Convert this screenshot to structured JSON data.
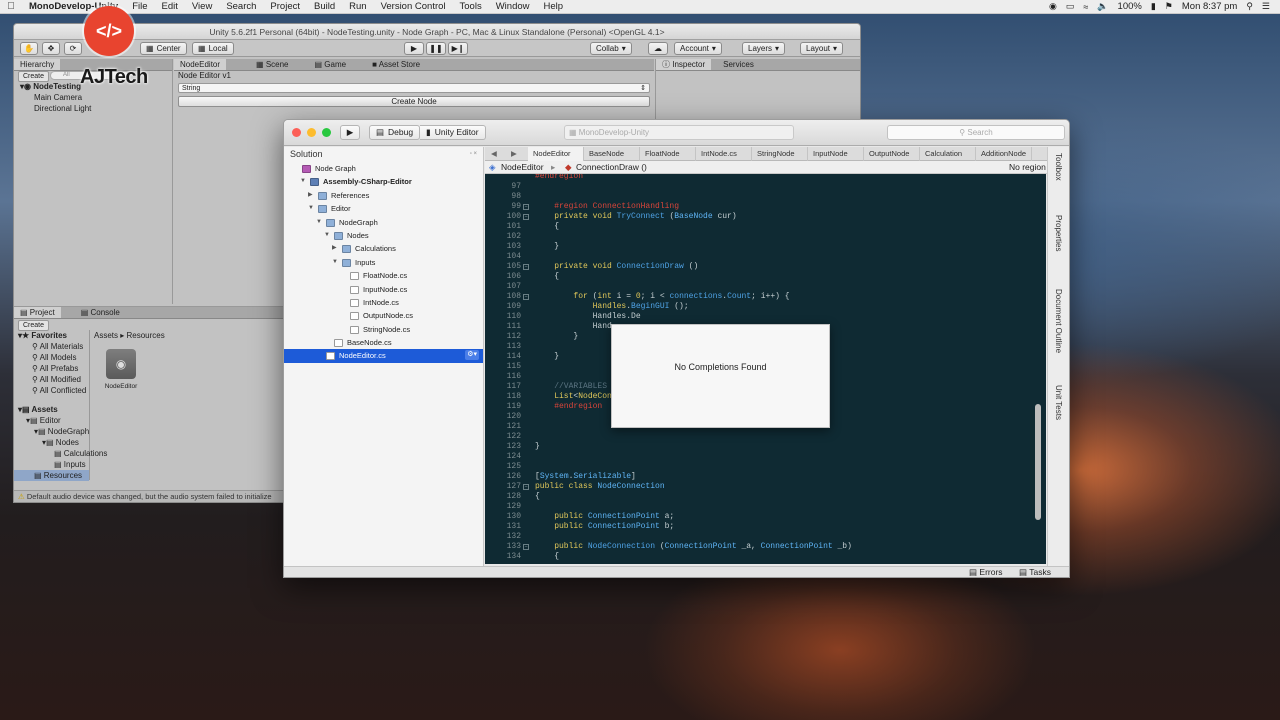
{
  "menubar": {
    "app": "MonoDevelop-Unity",
    "items": [
      "File",
      "Edit",
      "View",
      "Search",
      "Project",
      "Build",
      "Run",
      "Version Control",
      "Tools",
      "Window",
      "Help"
    ],
    "battery": "100%",
    "clock": "Mon 8:37 pm"
  },
  "watermark": {
    "text": "AJTech"
  },
  "unity": {
    "title": "Unity 5.6.2f1 Personal (64bit) - NodeTesting.unity - Node Graph - PC, Mac & Linux Standalone (Personal) <OpenGL 4.1>",
    "toolbar": {
      "center": "Center",
      "local": "Local",
      "collab": "Collab",
      "account": "Account",
      "layers": "Layers",
      "layout": "Layout"
    },
    "hierarchy": {
      "tab": "Hierarchy",
      "create": "Create",
      "search": "All",
      "scene": "NodeTesting",
      "items": [
        "Main Camera",
        "Directional Light"
      ]
    },
    "tabs": [
      "NodeEditor",
      "Scene",
      "Game",
      "Asset Store"
    ],
    "node_editor": {
      "title": "Node Editor v1",
      "field": "String",
      "button": "Create Node"
    },
    "inspector_tabs": [
      "Inspector",
      "Services"
    ],
    "project": {
      "tabs": [
        "Project",
        "Console"
      ],
      "create": "Create",
      "favorites": "Favorites",
      "fav_items": [
        "All Materials",
        "All Models",
        "All Prefabs",
        "All Modified",
        "All Conflicted"
      ],
      "assets": "Assets",
      "tree": [
        "Editor",
        "NodeGraph",
        "Nodes",
        "Calculations",
        "Inputs"
      ],
      "resources": "Resources",
      "breadcrumb": [
        "Assets",
        "Resources"
      ],
      "asset": "NodeEditor"
    },
    "status": "Default audio device was changed, but the audio system failed to initialize"
  },
  "md": {
    "config": "Debug",
    "target": "Unity Editor",
    "addr": "MonoDevelop-Unity",
    "search": "Search",
    "solution": {
      "title": "Solution",
      "items": [
        {
          "label": "Node Graph",
          "level": 0,
          "kind": "solution",
          "expanded": null
        },
        {
          "label": "Assembly-CSharp-Editor",
          "level": 1,
          "kind": "project",
          "expanded": true
        },
        {
          "label": "References",
          "level": 2,
          "kind": "folder",
          "expanded": false
        },
        {
          "label": "Editor",
          "level": 2,
          "kind": "folder",
          "expanded": true
        },
        {
          "label": "NodeGraph",
          "level": 3,
          "kind": "folder",
          "expanded": true
        },
        {
          "label": "Nodes",
          "level": 4,
          "kind": "folder",
          "expanded": true
        },
        {
          "label": "Calculations",
          "level": 5,
          "kind": "folder",
          "expanded": false
        },
        {
          "label": "Inputs",
          "level": 5,
          "kind": "folder",
          "expanded": true
        },
        {
          "label": "FloatNode.cs",
          "level": 6,
          "kind": "file",
          "expanded": null
        },
        {
          "label": "InputNode.cs",
          "level": 6,
          "kind": "file",
          "expanded": null
        },
        {
          "label": "IntNode.cs",
          "level": 6,
          "kind": "file",
          "expanded": null
        },
        {
          "label": "OutputNode.cs",
          "level": 6,
          "kind": "file",
          "expanded": null
        },
        {
          "label": "StringNode.cs",
          "level": 6,
          "kind": "file",
          "expanded": null
        },
        {
          "label": "BaseNode.cs",
          "level": 4,
          "kind": "file",
          "expanded": null
        },
        {
          "label": "NodeEditor.cs",
          "level": 3,
          "kind": "file",
          "expanded": null,
          "selected": true
        }
      ]
    },
    "tabs": [
      "NodeEditor",
      "BaseNode",
      "FloatNode",
      "IntNode.cs",
      "StringNode",
      "InputNode",
      "OutputNode",
      "Calculation",
      "AdditionNode"
    ],
    "path": {
      "class": "NodeEditor",
      "method": "ConnectionDraw ()",
      "region": "No region"
    },
    "code": [
      {
        "n": "",
        "s": [
          [
            "r",
            "#endregion"
          ]
        ]
      },
      {
        "n": "97",
        "s": []
      },
      {
        "n": "98",
        "s": []
      },
      {
        "n": "99",
        "fold": true,
        "s": [
          [
            "",
            "    "
          ],
          [
            "r",
            "#region ConnectionHandling"
          ]
        ]
      },
      {
        "n": "100",
        "fold": true,
        "s": [
          [
            "",
            "    "
          ],
          [
            "k",
            "private void "
          ],
          [
            "f",
            "TryConnect"
          ],
          [
            "",
            " ("
          ],
          [
            "t",
            "BaseNode"
          ],
          [
            "",
            " cur)"
          ]
        ]
      },
      {
        "n": "101",
        "s": [
          [
            "",
            "    {"
          ]
        ]
      },
      {
        "n": "102",
        "s": []
      },
      {
        "n": "103",
        "s": [
          [
            "",
            "    }"
          ]
        ]
      },
      {
        "n": "104",
        "s": []
      },
      {
        "n": "105",
        "fold": true,
        "s": [
          [
            "",
            "    "
          ],
          [
            "k",
            "private void "
          ],
          [
            "f",
            "ConnectionDraw"
          ],
          [
            "",
            " ()"
          ]
        ]
      },
      {
        "n": "106",
        "s": [
          [
            "",
            "    {"
          ]
        ]
      },
      {
        "n": "107",
        "s": []
      },
      {
        "n": "108",
        "fold": true,
        "s": [
          [
            "",
            "        "
          ],
          [
            "k",
            "for"
          ],
          [
            "",
            " ("
          ],
          [
            "k",
            "int"
          ],
          [
            "",
            " i = "
          ],
          [
            "k",
            "0"
          ],
          [
            "",
            "; i < "
          ],
          [
            "f",
            "connections"
          ],
          [
            "",
            "."
          ],
          [
            "f",
            "Count"
          ],
          [
            "",
            "; i++) {"
          ]
        ]
      },
      {
        "n": "109",
        "s": [
          [
            "",
            "            "
          ],
          [
            "k",
            "Handles"
          ],
          [
            "",
            "."
          ],
          [
            "f",
            "BeginGUI"
          ],
          [
            "",
            " ();"
          ]
        ]
      },
      {
        "n": "110",
        "s": [
          [
            "",
            "            Handles.De"
          ]
        ]
      },
      {
        "n": "111",
        "s": [
          [
            "",
            "            Hand"
          ]
        ]
      },
      {
        "n": "112",
        "s": [
          [
            "",
            "        }"
          ]
        ]
      },
      {
        "n": "113",
        "s": []
      },
      {
        "n": "114",
        "s": [
          [
            "",
            "    }"
          ]
        ]
      },
      {
        "n": "115",
        "s": []
      },
      {
        "n": "116",
        "s": []
      },
      {
        "n": "117",
        "s": [
          [
            "",
            "    "
          ],
          [
            "c",
            "//VARIABLES"
          ]
        ]
      },
      {
        "n": "118",
        "s": [
          [
            "",
            "    "
          ],
          [
            "k",
            "List"
          ],
          [
            "",
            "<"
          ],
          [
            "k",
            "NodeCon"
          ],
          [
            "",
            "                                      > ();"
          ]
        ]
      },
      {
        "n": "119",
        "s": [
          [
            "",
            "    "
          ],
          [
            "r",
            "#endregion"
          ]
        ]
      },
      {
        "n": "120",
        "s": []
      },
      {
        "n": "121",
        "s": []
      },
      {
        "n": "122",
        "s": []
      },
      {
        "n": "123",
        "s": [
          [
            "",
            "}"
          ]
        ]
      },
      {
        "n": "124",
        "s": []
      },
      {
        "n": "125",
        "s": []
      },
      {
        "n": "126",
        "s": [
          [
            "",
            "["
          ],
          [
            "t",
            "System"
          ],
          [
            "",
            "."
          ],
          [
            "t",
            "Serializable"
          ],
          [
            "",
            "]"
          ]
        ]
      },
      {
        "n": "127",
        "fold": true,
        "s": [
          [
            "k",
            "public class "
          ],
          [
            "t",
            "NodeConnection"
          ]
        ]
      },
      {
        "n": "128",
        "s": [
          [
            "",
            "{"
          ]
        ]
      },
      {
        "n": "129",
        "s": []
      },
      {
        "n": "130",
        "s": [
          [
            "",
            "    "
          ],
          [
            "k",
            "public "
          ],
          [
            "t",
            "ConnectionPoint"
          ],
          [
            "",
            " a;"
          ]
        ]
      },
      {
        "n": "131",
        "s": [
          [
            "",
            "    "
          ],
          [
            "k",
            "public "
          ],
          [
            "t",
            "ConnectionPoint"
          ],
          [
            "",
            " b;"
          ]
        ]
      },
      {
        "n": "132",
        "s": []
      },
      {
        "n": "133",
        "fold": true,
        "s": [
          [
            "",
            "    "
          ],
          [
            "k",
            "public "
          ],
          [
            "f",
            "NodeConnection"
          ],
          [
            "",
            " ("
          ],
          [
            "t",
            "ConnectionPoint"
          ],
          [
            "",
            " _a, "
          ],
          [
            "t",
            "ConnectionPoint"
          ],
          [
            "",
            " _b)"
          ]
        ]
      },
      {
        "n": "134",
        "s": [
          [
            "",
            "    {"
          ]
        ]
      }
    ],
    "popup": "No Completions Found",
    "side_tabs": [
      "Toolbox",
      "Properties",
      "Document Outline",
      "Unit Tests"
    ],
    "status": {
      "errors": "Errors",
      "tasks": "Tasks"
    }
  },
  "colors": {
    "editor_bg": "#0f2a33",
    "keyword": "#e0c75a",
    "type": "#5fb4f5",
    "region": "#d9453a",
    "selection": "#1d5bd8",
    "logo": "#e8442f"
  }
}
